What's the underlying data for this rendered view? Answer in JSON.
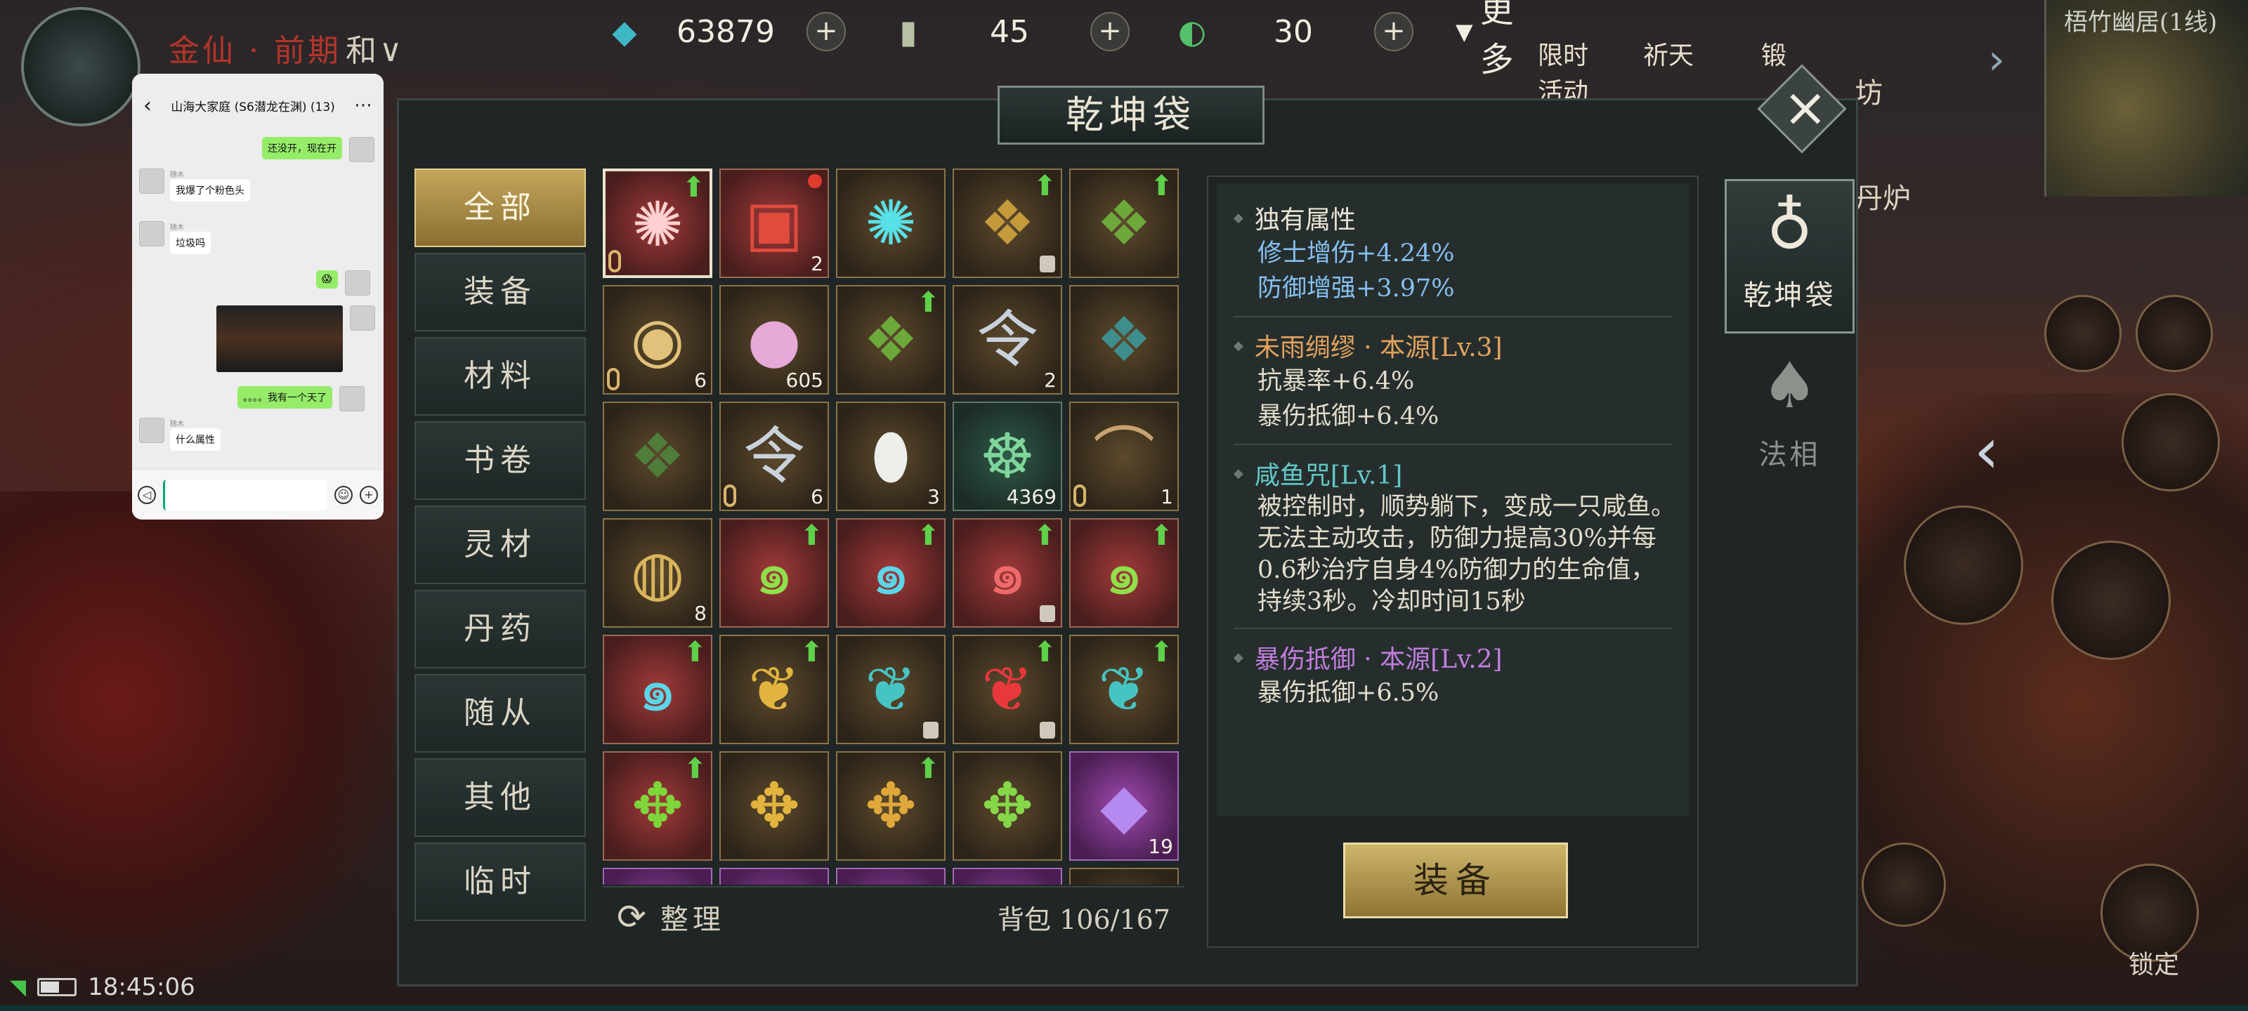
{
  "top": {
    "player_title": "金仙 · 前期",
    "player_title_suffix": "和∨",
    "currencies": [
      {
        "icon": "spirit-stone-icon",
        "glyph": "◆",
        "color": "#3fb7c4",
        "value": "63879"
      },
      {
        "icon": "token-icon",
        "glyph": "▮",
        "color": "#b8c0a4",
        "value": "45"
      },
      {
        "icon": "jade-icon",
        "glyph": "◐",
        "color": "#53c16a",
        "value": "30"
      }
    ],
    "more_label": "更多",
    "icon_labels": [
      "限时活动",
      "祈天",
      "锻"
    ],
    "fang_label": "坊",
    "furnace_label": "丹炉"
  },
  "minimap": {
    "title": "梧竹幽居(1线)"
  },
  "chat": {
    "title": "山海大家庭 (S6潜龙在渊) (13)",
    "messages": [
      {
        "side": "right",
        "text": "还没开，现在开"
      },
      {
        "side": "left",
        "name": "随木",
        "text": "我爆了个粉色头"
      },
      {
        "side": "left",
        "name": "随木",
        "text": "垃圾吗"
      },
      {
        "side": "right",
        "text": "😱"
      },
      {
        "side": "right",
        "text": "[image]"
      },
      {
        "side": "right",
        "text": "。。。。我有一个天了"
      },
      {
        "side": "left",
        "name": "随木",
        "text": "什么属性"
      }
    ]
  },
  "bag": {
    "title": "乾坤袋",
    "categories": [
      "全部",
      "装备",
      "材料",
      "书卷",
      "灵材",
      "丹药",
      "随从",
      "其他",
      "临时"
    ],
    "active_category": 0,
    "sort_label": "整理",
    "capacity_label": "背包",
    "capacity": "106/167",
    "items": [
      {
        "name": "red-talisman-item",
        "glyph": "✺",
        "color": "#ffd0d0",
        "q": "q-red",
        "count": "",
        "up": true,
        "lock": false,
        "bind": true,
        "selected": true
      },
      {
        "name": "treasure-chest-item",
        "glyph": "▣",
        "color": "#e04b3b",
        "q": "q-red",
        "count": "2",
        "up": false,
        "lock": false,
        "bind": false,
        "dot": true
      },
      {
        "name": "cyan-sigil-item",
        "glyph": "✺",
        "color": "#58e0e8",
        "q": "q-gold",
        "count": "",
        "up": false,
        "lock": false,
        "bind": false
      },
      {
        "name": "dragon-crest-item",
        "glyph": "❖",
        "color": "#c59a3a",
        "q": "q-gold",
        "count": "",
        "up": true,
        "lock": true,
        "bind": false
      },
      {
        "name": "dragon-crest-green-item",
        "glyph": "❖",
        "color": "#6ca83a",
        "q": "q-gold",
        "count": "",
        "up": true,
        "lock": false,
        "bind": false
      },
      {
        "name": "gold-coin-item",
        "glyph": "◉",
        "color": "#e2c27a",
        "q": "q-gold",
        "count": "6",
        "up": false,
        "lock": false,
        "bind": true
      },
      {
        "name": "pink-pearl-item",
        "glyph": "●",
        "color": "#e6a9d8",
        "q": "q-gold",
        "count": "605",
        "up": false,
        "lock": false,
        "bind": false
      },
      {
        "name": "dragon-crest-green-item",
        "glyph": "❖",
        "color": "#6ca83a",
        "q": "q-gold",
        "count": "",
        "up": true,
        "lock": false,
        "bind": false
      },
      {
        "name": "order-token-item",
        "glyph": "令",
        "color": "#c9d1dc",
        "q": "q-gold",
        "count": "2",
        "up": false,
        "lock": false,
        "bind": false
      },
      {
        "name": "dragon-crest-teal-item",
        "glyph": "❖",
        "color": "#3f8e8e",
        "q": "q-gold",
        "count": "",
        "up": false,
        "lock": false,
        "bind": false
      },
      {
        "name": "dragon-crest-dark-item",
        "glyph": "❖",
        "color": "#4f7d3a",
        "q": "q-gold",
        "count": "",
        "up": false,
        "lock": false,
        "bind": false
      },
      {
        "name": "order-token-item",
        "glyph": "令",
        "color": "#c9d1dc",
        "q": "q-gold",
        "count": "6",
        "up": false,
        "lock": false,
        "bind": true
      },
      {
        "name": "white-jade-item",
        "glyph": "⬮",
        "color": "#eeeeea",
        "q": "q-gold",
        "count": "3",
        "up": false,
        "lock": false,
        "bind": false
      },
      {
        "name": "jade-buddha-item",
        "glyph": "☸",
        "color": "#7fd59a",
        "q": "q-green",
        "count": "4369",
        "up": false,
        "lock": false,
        "bind": false
      },
      {
        "name": "fishing-rod-item",
        "glyph": "⌒",
        "color": "#c8a270",
        "q": "q-gold",
        "count": "1",
        "up": false,
        "lock": false,
        "bind": true
      },
      {
        "name": "dish-item",
        "glyph": "◍",
        "color": "#d9b45b",
        "q": "q-gold",
        "count": "8",
        "up": false,
        "lock": false,
        "bind": false
      },
      {
        "name": "green-swirl-item",
        "glyph": "๑",
        "color": "#8fe04a",
        "q": "q-red",
        "count": "",
        "up": true,
        "lock": false,
        "bind": false
      },
      {
        "name": "cyan-swirl-item",
        "glyph": "๑",
        "color": "#5ad6e8",
        "q": "q-red",
        "count": "",
        "up": true,
        "lock": false,
        "bind": false
      },
      {
        "name": "red-swirl-item",
        "glyph": "๑",
        "color": "#ee6a6a",
        "q": "q-red",
        "count": "",
        "up": true,
        "lock": true,
        "bind": false
      },
      {
        "name": "green-swirl-item",
        "glyph": "๑",
        "color": "#8fe04a",
        "q": "q-red",
        "count": "",
        "up": true,
        "lock": false,
        "bind": false
      },
      {
        "name": "cyan-swirl-item",
        "glyph": "๑",
        "color": "#5ad6e8",
        "q": "q-red",
        "count": "",
        "up": true,
        "lock": false,
        "bind": false
      },
      {
        "name": "gold-wisp-item",
        "glyph": "❦",
        "color": "#e2b43e",
        "q": "q-gold",
        "count": "",
        "up": true,
        "lock": false,
        "bind": false
      },
      {
        "name": "teal-wisp-item",
        "glyph": "❦",
        "color": "#46c4c4",
        "q": "q-gold",
        "count": "",
        "up": false,
        "lock": true,
        "bind": false
      },
      {
        "name": "red-wisp-item",
        "glyph": "❦",
        "color": "#e8383c",
        "q": "q-gold",
        "count": "",
        "up": true,
        "lock": true,
        "bind": false
      },
      {
        "name": "teal-wisp-item",
        "glyph": "❦",
        "color": "#46c4c4",
        "q": "q-gold",
        "count": "",
        "up": true,
        "lock": false,
        "bind": false
      },
      {
        "name": "green-mask-item",
        "glyph": "✥",
        "color": "#7ed63a",
        "q": "q-red",
        "count": "",
        "up": true,
        "lock": false,
        "bind": false
      },
      {
        "name": "gold-mask-item",
        "glyph": "✥",
        "color": "#e2b43e",
        "q": "q-gold",
        "count": "",
        "up": false,
        "lock": false,
        "bind": false
      },
      {
        "name": "gold-dragon-item",
        "glyph": "✥",
        "color": "#e0a83a",
        "q": "q-gold",
        "count": "",
        "up": true,
        "lock": false,
        "bind": false
      },
      {
        "name": "green-dragon-item",
        "glyph": "✥",
        "color": "#86d84a",
        "q": "q-gold",
        "count": "",
        "up": false,
        "lock": false,
        "bind": false
      },
      {
        "name": "purple-crystal-item",
        "glyph": "◆",
        "color": "#b58af0",
        "q": "q-purple",
        "count": "19",
        "up": false,
        "lock": false,
        "bind": false
      }
    ]
  },
  "detail": {
    "unique_attr_title": "独有属性",
    "unique_attrs": [
      "修士增伤+4.24%",
      "防御增强+3.97%"
    ],
    "skills": [
      {
        "title": "未雨绸缪 · 本源[Lv.3]",
        "color": "orange",
        "lines": [
          "抗暴率+6.4%",
          "暴伤抵御+6.4%"
        ]
      },
      {
        "title": "咸鱼咒[Lv.1]",
        "color": "cyan",
        "lines": [
          "被控制时，顺势躺下，变成一只咸鱼。无法主动攻击，防御力提高30%并每0.6秒治疗自身4%防御力的生命值，持续3秒。冷却时间15秒"
        ]
      },
      {
        "title": "暴伤抵御 · 本源[Lv.2]",
        "color": "purple",
        "lines": [
          "暴伤抵御+6.5%"
        ]
      }
    ],
    "equip_label": "装备"
  },
  "right_tabs": [
    {
      "label": "乾坤袋",
      "icon": "bag-icon",
      "active": true
    },
    {
      "label": "法相",
      "icon": "avatar-form-icon",
      "active": false
    }
  ],
  "hud": {
    "lock_label": "锁定"
  },
  "status": {
    "time": "18:45:06"
  }
}
